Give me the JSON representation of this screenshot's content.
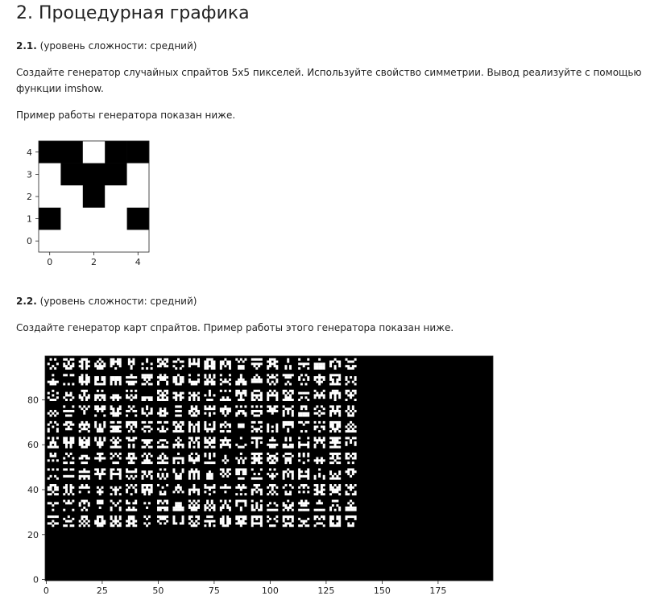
{
  "heading": "2. Процедурная графика",
  "task1": {
    "number": "2.1.",
    "level": " (уровень сложности: средний)",
    "text": "Создайте генератор случайных спрайтов 5x5 пикселей. Используйте свойство симметрии. Вывод реализуйте с помощью функции imshow.",
    "example": "Пример работы генератора показан ниже."
  },
  "task2": {
    "number": "2.2.",
    "level": " (уровень сложности: средний)",
    "text": "Создайте генератор карт спрайтов. Пример работы этого генератора показан ниже."
  },
  "colors": {
    "ink": "#000000",
    "paper": "#ffffff",
    "tick": "#222222"
  },
  "chart_data": [
    {
      "type": "heatmap",
      "grid": [
        [
          1,
          1,
          0,
          1,
          1
        ],
        [
          0,
          1,
          1,
          1,
          0
        ],
        [
          0,
          0,
          1,
          0,
          0
        ],
        [
          1,
          0,
          0,
          0,
          1
        ],
        [
          0,
          0,
          0,
          0,
          0
        ]
      ],
      "x_ticks": [
        "0",
        "2",
        "4"
      ],
      "y_ticks": [
        "0",
        "1",
        "2",
        "3",
        "4"
      ],
      "xlim": [
        -0.5,
        4.5
      ],
      "ylim": [
        4.5,
        -0.5
      ]
    },
    {
      "type": "heatmap",
      "x_ticks": [
        "0",
        "25",
        "50",
        "75",
        "100",
        "125",
        "150",
        "175"
      ],
      "y_ticks": [
        "0",
        "20",
        "40",
        "60",
        "80"
      ],
      "xlim": [
        -0.5,
        199.5
      ],
      "ylim": [
        99.5,
        -0.5
      ],
      "sprite_grid": {
        "rows": 11,
        "cols": 20,
        "sprite_size": 5,
        "gap": 2
      }
    }
  ]
}
